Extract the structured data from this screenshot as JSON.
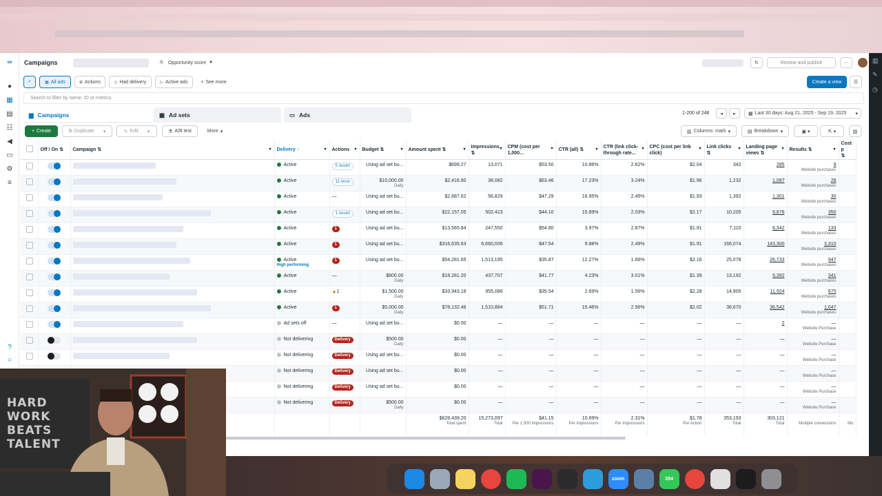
{
  "header": {
    "title": "Campaigns",
    "opportunity_score": "0",
    "opportunity_label": "Opportunity score",
    "review_publish": "Review and publish"
  },
  "filters": {
    "all_ads": "All ads",
    "actions": "Actions",
    "had_delivery": "Had delivery",
    "active_ads": "Active ads",
    "see_more": "See more",
    "create_view": "Create a view",
    "search_placeholder": "Search to filter by name, ID or metrics"
  },
  "tabs": {
    "campaigns": "Campaigns",
    "adsets": "Ad sets",
    "ads": "Ads"
  },
  "pagination": {
    "range": "1-200 of 248",
    "date_range": "Last 30 days: Aug 21, 2025 - Sep 19, 2025"
  },
  "toolbar": {
    "create": "Create",
    "duplicate": "Duplicate",
    "edit": "Edit",
    "ab_test": "A/B test",
    "more": "More",
    "columns": "Columns: mark",
    "breakdown": "Breakdown"
  },
  "columns": [
    "Off / On",
    "Campaign",
    "Delivery",
    "Actions",
    "Budget",
    "Amount spent",
    "Impressions",
    "CPM (cost per 1,000...",
    "CTR (all)",
    "CTR (link click-through rate...",
    "CPC (cost per link click)",
    "Link clicks",
    "Landing page views",
    "Results",
    "Cost p"
  ],
  "rows": [
    {
      "on": true,
      "delivery": "Active",
      "dcolor": "#1d7a3e",
      "hp": "",
      "action": "5 recom",
      "atype": "blue",
      "budget": "Using ad set bu...",
      "bsub": "",
      "spent": "$699.27",
      "impr": "13,071",
      "cpm": "$53.50",
      "ctr": "10.86%",
      "ctrl": "2.62%",
      "cpc": "$2.04",
      "clicks": "342",
      "lpv": "285",
      "res": "9",
      "rsub": "Website purchases"
    },
    {
      "on": true,
      "delivery": "Active",
      "dcolor": "#1d7a3e",
      "hp": "",
      "action": "11 recor",
      "atype": "blue",
      "budget": "$10,000.00",
      "bsub": "Daily",
      "spent": "$2,416.80",
      "impr": "38,082",
      "cpm": "$63.46",
      "ctr": "17.23%",
      "ctrl": "3.24%",
      "cpc": "$1.96",
      "clicks": "1,232",
      "lpv": "1,087",
      "res": "28",
      "rsub": "Website purchases"
    },
    {
      "on": true,
      "delivery": "Active",
      "dcolor": "#1d7a3e",
      "hp": "",
      "action": "—",
      "atype": "none",
      "budget": "Using ad set bu...",
      "bsub": "",
      "spent": "$2,687.62",
      "impr": "56,829",
      "cpm": "$47.29",
      "ctr": "16.95%",
      "ctrl": "2.45%",
      "cpc": "$1.93",
      "clicks": "1,392",
      "lpv": "1,301",
      "res": "30",
      "rsub": "Website purchases"
    },
    {
      "on": true,
      "delivery": "Active",
      "dcolor": "#1d7a3e",
      "hp": "",
      "action": "1 recom",
      "atype": "blue",
      "budget": "Using ad set bu...",
      "bsub": "",
      "spent": "$22,157.05",
      "impr": "502,423",
      "cpm": "$44.10",
      "ctr": "15.89%",
      "ctrl": "2.03%",
      "cpc": "$2.17",
      "clicks": "10,205",
      "lpv": "9,876",
      "res": "350",
      "rsub": "Website purchases"
    },
    {
      "on": true,
      "delivery": "Active",
      "dcolor": "#1d7a3e",
      "hp": "",
      "action": "1",
      "atype": "red",
      "budget": "Using ad set bu...",
      "bsub": "",
      "spent": "$13,565.84",
      "impr": "247,550",
      "cpm": "$54.80",
      "ctr": "3.97%",
      "ctrl": "2.87%",
      "cpc": "$1.91",
      "clicks": "7,110",
      "lpv": "6,342",
      "res": "133",
      "rsub": "Website purchases"
    },
    {
      "on": true,
      "delivery": "Active",
      "dcolor": "#1d7a3e",
      "hp": "",
      "action": "1",
      "atype": "red",
      "budget": "Using ad set bu...",
      "bsub": "",
      "spent": "$316,635.63",
      "impr": "6,660,006",
      "cpm": "$47.54",
      "ctr": "9.88%",
      "ctrl": "2.49%",
      "cpc": "$1.91",
      "clicks": "166,074",
      "lpv": "143,300",
      "res": "3,310",
      "rsub": "Website purchases"
    },
    {
      "on": true,
      "delivery": "Active",
      "dcolor": "#1d7a3e",
      "hp": "High performing",
      "action": "1",
      "atype": "red",
      "budget": "Using ad set bu...",
      "bsub": "",
      "spent": "$54,281.65",
      "impr": "1,513,195",
      "cpm": "$35.87",
      "ctr": "12.27%",
      "ctrl": "1.66%",
      "cpc": "$2.16",
      "clicks": "25,078",
      "lpv": "26,733",
      "res": "947",
      "rsub": "Website purchases"
    },
    {
      "on": true,
      "delivery": "Active",
      "dcolor": "#1d7a3e",
      "hp": "",
      "action": "—",
      "atype": "none",
      "budget": "$800.00",
      "bsub": "Daily",
      "spent": "$18,281.20",
      "impr": "437,707",
      "cpm": "$41.77",
      "ctr": "4.23%",
      "ctrl": "3.01%",
      "cpc": "$1.39",
      "clicks": "13,192",
      "lpv": "9,392",
      "res": "341",
      "rsub": "Website purchases"
    },
    {
      "on": true,
      "delivery": "Active",
      "dcolor": "#1d7a3e",
      "hp": "",
      "action": "1",
      "atype": "warn",
      "budget": "$1,500.00",
      "bsub": "Daily",
      "spent": "$33,943.18",
      "impr": "955,086",
      "cpm": "$35.54",
      "ctr": "2.69%",
      "ctrl": "1.56%",
      "cpc": "$2.28",
      "clicks": "14,905",
      "lpv": "11,924",
      "res": "675",
      "rsub": "Website purchases"
    },
    {
      "on": true,
      "delivery": "Active",
      "dcolor": "#1d7a3e",
      "hp": "",
      "action": "1",
      "atype": "red",
      "budget": "$5,000.00",
      "bsub": "Daily",
      "spent": "$78,132.46",
      "impr": "1,510,884",
      "cpm": "$51.71",
      "ctr": "15.46%",
      "ctrl": "2.56%",
      "cpc": "$2.02",
      "clicks": "38,670",
      "lpv": "36,542",
      "res": "1,047",
      "rsub": "Website purchases"
    },
    {
      "on": true,
      "delivery": "Ad sets off",
      "dcolor": "#bcc0c4",
      "hp": "",
      "action": "—",
      "atype": "none",
      "budget": "Using ad set bu...",
      "bsub": "",
      "spent": "$0.00",
      "impr": "—",
      "cpm": "—",
      "ctr": "—",
      "ctrl": "—",
      "cpc": "—",
      "clicks": "—",
      "lpv": "2",
      "res": "—",
      "rsub": "Website Purchase"
    },
    {
      "on": false,
      "delivery": "Not delivering",
      "dcolor": "#bcc0c4",
      "hp": "",
      "action": "Delivery",
      "atype": "red",
      "budget": "$500.00",
      "bsub": "Daily",
      "spent": "$0.00",
      "impr": "—",
      "cpm": "—",
      "ctr": "—",
      "ctrl": "—",
      "cpc": "—",
      "clicks": "—",
      "lpv": "—",
      "res": "—",
      "rsub": "Website Purchase"
    },
    {
      "on": false,
      "delivery": "Not delivering",
      "dcolor": "#bcc0c4",
      "hp": "",
      "action": "Delivery",
      "atype": "red",
      "budget": "Using ad set bu...",
      "bsub": "",
      "spent": "$0.00",
      "impr": "—",
      "cpm": "—",
      "ctr": "—",
      "ctrl": "—",
      "cpc": "—",
      "clicks": "—",
      "lpv": "—",
      "res": "—",
      "rsub": "Website Purchase"
    },
    {
      "on": false,
      "delivery": "Not delivering",
      "dcolor": "#bcc0c4",
      "hp": "",
      "action": "Delivery",
      "atype": "red",
      "budget": "Using ad set bu...",
      "bsub": "",
      "spent": "$0.00",
      "impr": "—",
      "cpm": "—",
      "ctr": "—",
      "ctrl": "—",
      "cpc": "—",
      "clicks": "—",
      "lpv": "—",
      "res": "—",
      "rsub": "Website Purchase"
    },
    {
      "on": false,
      "delivery": "Not delivering",
      "dcolor": "#bcc0c4",
      "hp": "",
      "action": "Delivery",
      "atype": "red",
      "budget": "Using ad set bu...",
      "bsub": "",
      "spent": "$0.00",
      "impr": "—",
      "cpm": "—",
      "ctr": "—",
      "ctrl": "—",
      "cpc": "—",
      "clicks": "—",
      "lpv": "—",
      "res": "—",
      "rsub": "Website Purchase"
    },
    {
      "on": false,
      "delivery": "Not delivering",
      "dcolor": "#bcc0c4",
      "hp": "",
      "action": "Delivery",
      "atype": "red",
      "budget": "$500.00",
      "bsub": "Daily",
      "spent": "$0.00",
      "impr": "—",
      "cpm": "—",
      "ctr": "—",
      "ctrl": "—",
      "cpc": "—",
      "clicks": "—",
      "lpv": "—",
      "res": "—",
      "rsub": "Website Purchase"
    }
  ],
  "totals": {
    "spent": "$628,439.20",
    "spent_sub": "Total spent",
    "impr": "15,273,097",
    "impr_sub": "Total",
    "cpm": "$41.15",
    "cpm_sub": "Per 1,000 impressions",
    "ctr": "10.69%",
    "ctr_sub": "Per impressions",
    "ctrl": "2.31%",
    "ctrl_sub": "Per impressions",
    "cpc": "$1.78",
    "cpc_sub": "Per Action",
    "clicks": "353,193",
    "clicks_sub": "Total",
    "lpv": "303,121",
    "lpv_sub": "Total",
    "res_sub": "Multiple conversions",
    "cost_sub": "Mu"
  },
  "webcam": {
    "sign_text": "HARD WORK BEATS TALENT"
  },
  "dock": [
    {
      "name": "finder",
      "color": "#1e88e5",
      "label": ""
    },
    {
      "name": "launchpad",
      "color": "#9aa7b8",
      "label": ""
    },
    {
      "name": "notes",
      "color": "#f4d35e",
      "label": ""
    },
    {
      "name": "chrome",
      "color": "#e8453c",
      "label": ""
    },
    {
      "name": "spotify",
      "color": "#1db954",
      "label": ""
    },
    {
      "name": "slack",
      "color": "#4a154b",
      "label": ""
    },
    {
      "name": "obs",
      "color": "#2b2b2b",
      "label": ""
    },
    {
      "name": "quicktime",
      "color": "#2d9cdb",
      "label": ""
    },
    {
      "name": "zoom",
      "color": "#2d8cff",
      "label": "zoom"
    },
    {
      "name": "app",
      "color": "#5b7fa6",
      "label": ""
    },
    {
      "name": "messages",
      "color": "#34c759",
      "label": "354"
    },
    {
      "name": "chrome-2",
      "color": "#e8453c",
      "label": ""
    },
    {
      "name": "preview",
      "color": "#e0e0e0",
      "label": ""
    },
    {
      "name": "monitor",
      "color": "#1c1c1c",
      "label": ""
    },
    {
      "name": "trash",
      "color": "#8e8e93",
      "label": ""
    }
  ]
}
